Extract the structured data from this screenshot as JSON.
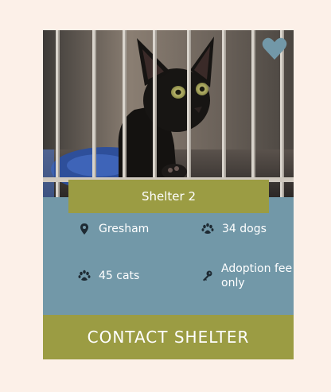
{
  "shelter": {
    "name": "Shelter 2",
    "location": "Gresham",
    "dogs": "34 dogs",
    "cats": "45 cats",
    "fee": "Adoption fee only",
    "contact_label": "CONTACT SHELTER"
  },
  "icons": {
    "favorite": "heart-icon",
    "location": "map-pin-icon",
    "dogs": "paw-icon",
    "cats": "paw-icon",
    "fee": "key-icon"
  },
  "colors": {
    "page_bg": "#fcf0e8",
    "card_bg": "#7298a8",
    "accent": "#9b9c43",
    "heart": "#7298a8",
    "text": "#ffffff"
  }
}
